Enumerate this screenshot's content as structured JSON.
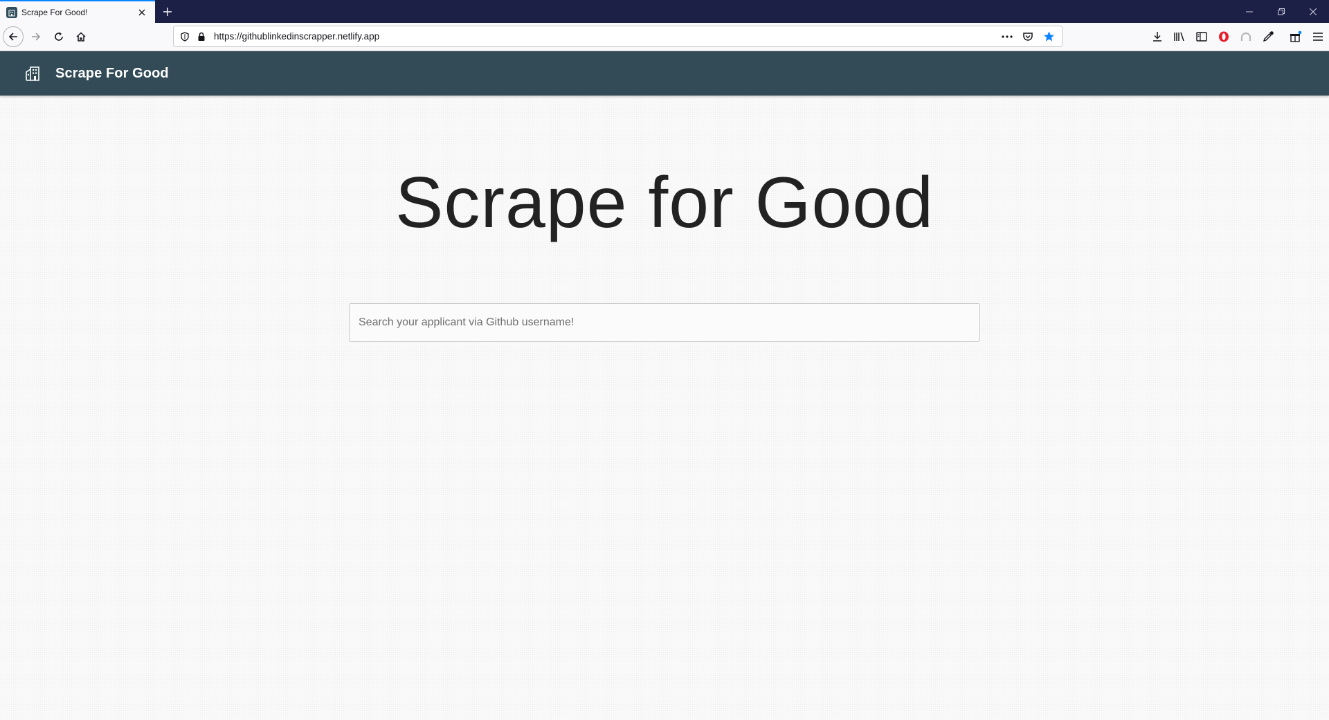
{
  "browser": {
    "tab": {
      "title": "Scrape For Good!",
      "favicon": "building-icon"
    },
    "url": "https://githublinkedinscrapper.netlify.app",
    "toolbar_icons": [
      "download-icon",
      "library-icon",
      "sidebar-icon",
      "opera-icon",
      "extension-icon",
      "eyedropper-icon",
      "gift-icon",
      "menu-icon"
    ]
  },
  "app": {
    "brand": "Scrape For Good",
    "hero_title": "Scrape for Good",
    "search": {
      "placeholder": "Search your applicant via Github username!",
      "value": ""
    },
    "colors": {
      "header_bg": "#324b56",
      "tab_accent": "#0a84ff"
    }
  }
}
